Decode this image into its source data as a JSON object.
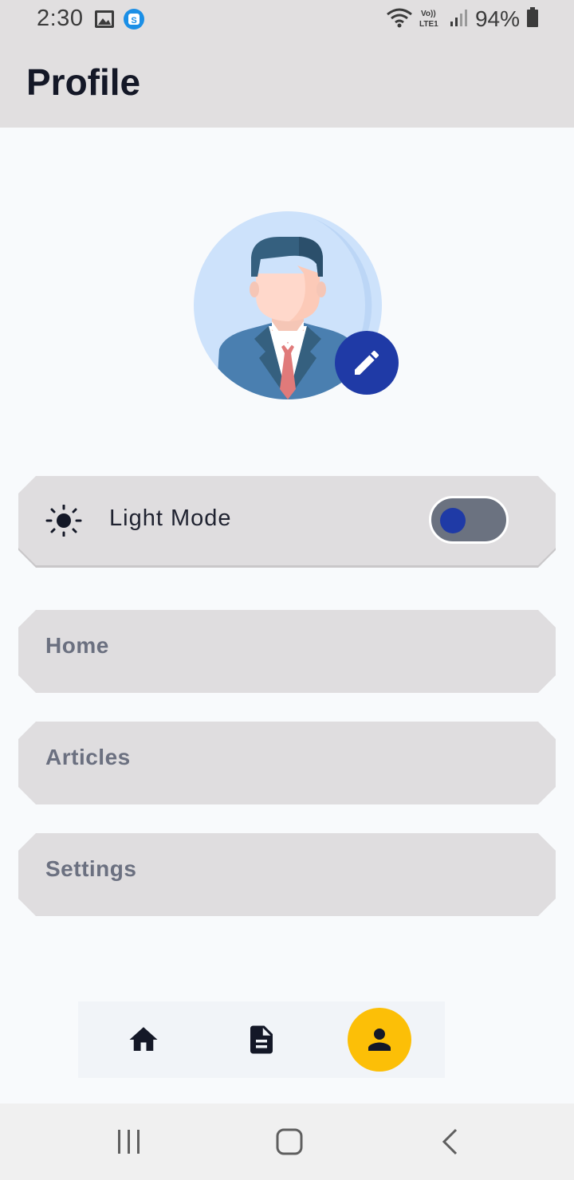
{
  "status_bar": {
    "time": "2:30",
    "battery_percent": "94%",
    "left_icons": [
      "image-icon",
      "s-app-icon"
    ],
    "right_icons": [
      "wifi-icon",
      "volte-icon",
      "signal-icon",
      "battery-icon"
    ]
  },
  "app_bar": {
    "title": "Profile"
  },
  "profile": {
    "avatar_icon": "user-avatar-illustration",
    "edit_icon": "pencil-icon"
  },
  "theme_setting": {
    "label": "Light Mode",
    "icon": "sun-icon",
    "toggle_on": false
  },
  "menu": [
    {
      "label": "Home"
    },
    {
      "label": "Articles"
    },
    {
      "label": "Settings"
    }
  ],
  "tab_bar": {
    "tabs": [
      {
        "icon": "home-icon",
        "selected": false
      },
      {
        "icon": "document-icon",
        "selected": false
      },
      {
        "icon": "person-icon",
        "selected": true
      }
    ],
    "accent": "#fcbf07"
  },
  "colors": {
    "primary": "#1f3aa6",
    "card_bg": "#dfdddf",
    "header_bg": "#e1dfe0"
  }
}
